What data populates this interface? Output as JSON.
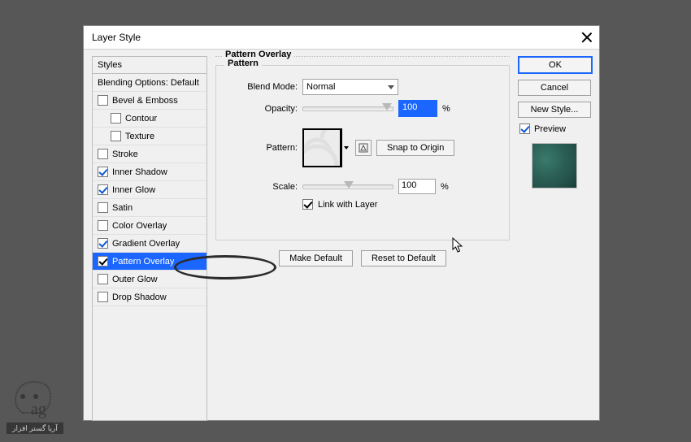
{
  "dialog": {
    "title": "Layer Style",
    "closeAria": "Close"
  },
  "stylesPanel": {
    "header": "Styles",
    "blending": "Blending Options: Default",
    "items": [
      {
        "label": "Bevel & Emboss",
        "checked": false,
        "indent": false
      },
      {
        "label": "Contour",
        "checked": false,
        "indent": true
      },
      {
        "label": "Texture",
        "checked": false,
        "indent": true
      },
      {
        "label": "Stroke",
        "checked": false,
        "indent": false
      },
      {
        "label": "Inner Shadow",
        "checked": true,
        "indent": false
      },
      {
        "label": "Inner Glow",
        "checked": true,
        "indent": false
      },
      {
        "label": "Satin",
        "checked": false,
        "indent": false
      },
      {
        "label": "Color Overlay",
        "checked": false,
        "indent": false
      },
      {
        "label": "Gradient Overlay",
        "checked": true,
        "indent": false
      },
      {
        "label": "Pattern Overlay",
        "checked": true,
        "indent": false,
        "selected": true
      },
      {
        "label": "Outer Glow",
        "checked": false,
        "indent": false
      },
      {
        "label": "Drop Shadow",
        "checked": false,
        "indent": false
      }
    ]
  },
  "centerPanel": {
    "outerTitle": "Pattern Overlay",
    "innerTitle": "Pattern",
    "blendModeLabel": "Blend Mode:",
    "blendModeValue": "Normal",
    "opacityLabel": "Opacity:",
    "opacityValue": "100",
    "percent": "%",
    "patternLabel": "Pattern:",
    "snapBtn": "Snap to Origin",
    "scaleLabel": "Scale:",
    "scaleValue": "100",
    "linkWithLayer": "Link with Layer",
    "linkChecked": true,
    "makeDefaultBtn": "Make Default",
    "resetDefaultBtn": "Reset to Default"
  },
  "rightPanel": {
    "ok": "OK",
    "cancel": "Cancel",
    "newStyle": "New Style...",
    "previewLabel": "Preview",
    "previewChecked": true
  }
}
